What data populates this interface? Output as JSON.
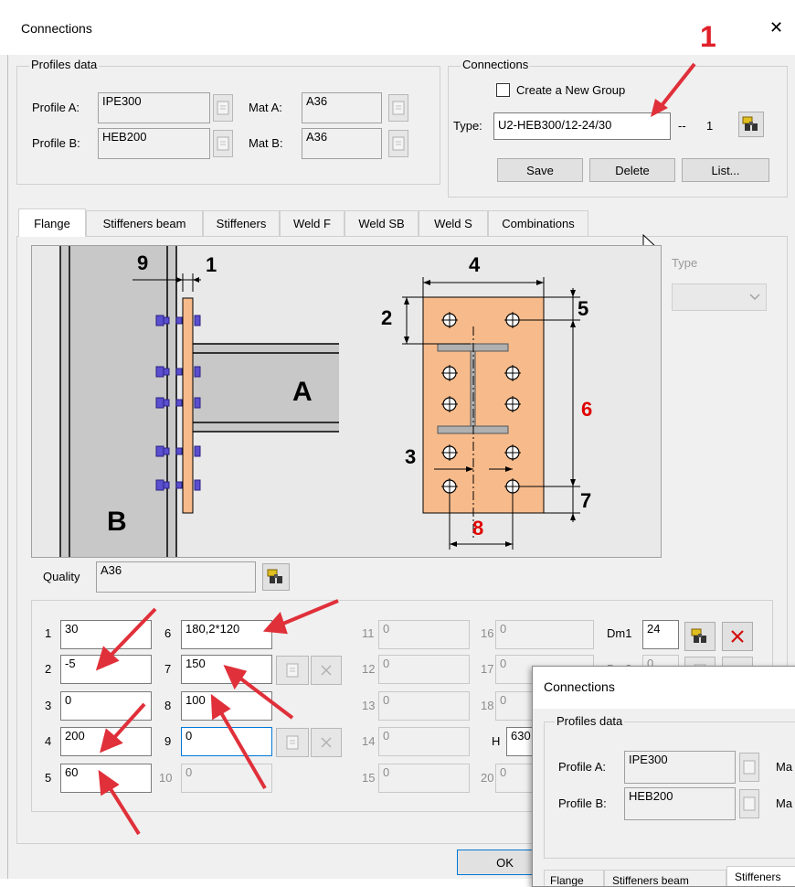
{
  "window": {
    "title": "Connections",
    "close_glyph": "✕"
  },
  "profiles": {
    "title": "Profiles data",
    "profile_a_label": "Profile A:",
    "profile_a_value": "IPE300",
    "profile_b_label": "Profile B:",
    "profile_b_value": "HEB200",
    "mat_a_label": "Mat A:",
    "mat_a_value": "A36",
    "mat_b_label": "Mat B:",
    "mat_b_value": "A36"
  },
  "connections": {
    "title": "Connections",
    "new_group_label": "Create a New Group",
    "type_label": "Type:",
    "type_value": "U2-HEB300/12-24/30",
    "separator": "--",
    "count": "1",
    "save": "Save",
    "delete": "Delete",
    "list": "List..."
  },
  "annotation": {
    "number": "1"
  },
  "tabs": [
    "Flange",
    "Stiffeners beam",
    "Stiffeners",
    "Weld F",
    "Weld SB",
    "Weld S",
    "Combinations"
  ],
  "type_dropdown": {
    "label": "Type",
    "value": ""
  },
  "drawing": {
    "dim_9": "9",
    "dim_1": "1",
    "dim_4": "4",
    "dim_5": "5",
    "dim_2": "2",
    "dim_6": "6",
    "dim_3": "3",
    "dim_7": "7",
    "dim_8": "8",
    "label_a": "A",
    "label_b": "B",
    "colors": {
      "plate": "#f7bb8b",
      "column": "#c8c8c8",
      "bolt": "#5a4fd0",
      "red": "#e00000"
    }
  },
  "quality": {
    "label": "Quality",
    "value": "A36"
  },
  "params": {
    "col1": [
      {
        "n": "1",
        "v": "30"
      },
      {
        "n": "2",
        "v": "-5"
      },
      {
        "n": "3",
        "v": "0"
      },
      {
        "n": "4",
        "v": "200"
      },
      {
        "n": "5",
        "v": "60"
      }
    ],
    "col2": [
      {
        "n": "6",
        "v": "180,2*120"
      },
      {
        "n": "7",
        "v": "150"
      },
      {
        "n": "8",
        "v": "100"
      },
      {
        "n": "9",
        "v": "0"
      },
      {
        "n": "10",
        "v": "0"
      }
    ],
    "col3": [
      {
        "n": "11",
        "v": "0"
      },
      {
        "n": "12",
        "v": "0"
      },
      {
        "n": "13",
        "v": "0"
      },
      {
        "n": "14",
        "v": "0"
      },
      {
        "n": "15",
        "v": "0"
      }
    ],
    "col4": [
      {
        "n": "16",
        "v": "0"
      },
      {
        "n": "17",
        "v": "0"
      },
      {
        "n": "18",
        "v": "0"
      },
      {
        "n": "H",
        "v": "630"
      },
      {
        "n": "20",
        "v": "0"
      }
    ],
    "dm1_label": "Dm1",
    "dm1_value": "24",
    "dm2_label": "Dm2",
    "dm2_value": "0"
  },
  "ok_button": "OK",
  "overlay": {
    "title": "Connections",
    "group_title": "Profiles data",
    "profile_a_label": "Profile A:",
    "profile_a_value": "IPE300",
    "profile_b_label": "Profile B:",
    "profile_b_value": "HEB200",
    "mat_fragment": "Ma",
    "tabs": [
      "Flange",
      "Stiffeners beam",
      "Stiffeners"
    ]
  }
}
